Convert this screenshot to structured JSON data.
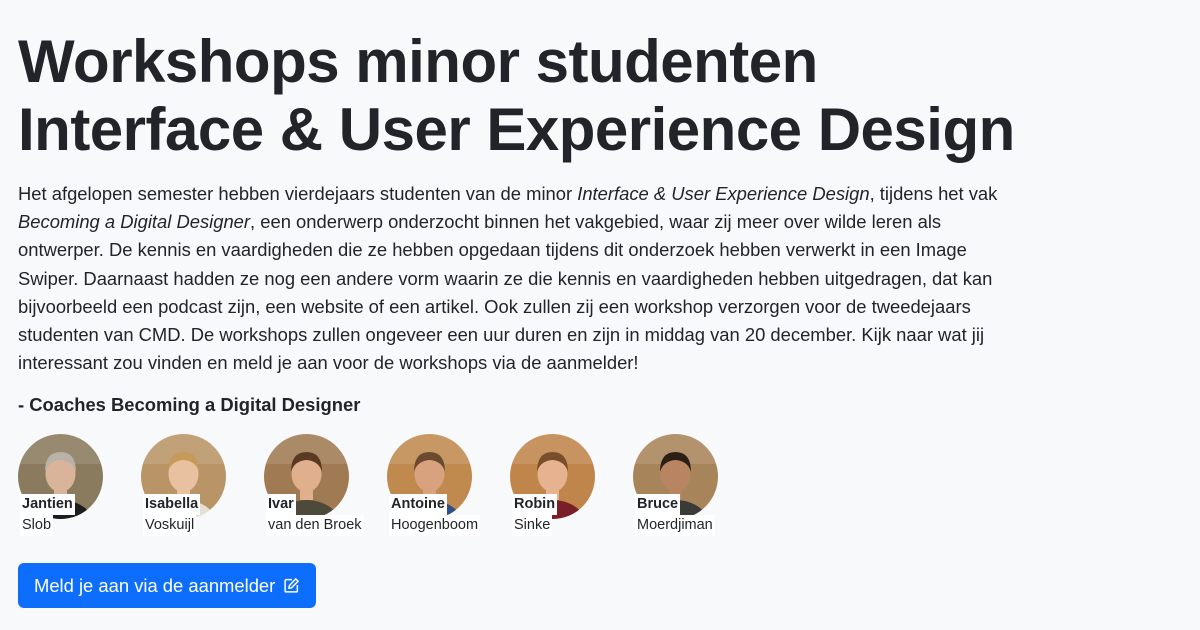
{
  "header": {
    "title_line1": "Workshops minor studenten",
    "title_line2": "Interface & User Experience Design"
  },
  "intro": {
    "p1": "Het afgelopen semester hebben vierdejaars studenten van de minor ",
    "minor_name": "Interface & User Experience Design",
    "p2": ", tijdens het vak ",
    "course_name": "Becoming a Digital Designer",
    "p3": ", een onderwerp onderzocht binnen het vakgebied, waar zij meer over wilde leren als ontwerper. De kennis en vaardigheden die ze hebben opgedaan tijdens dit onderzoek hebben verwerkt in een Image Swiper. Daarnaast hadden ze nog een andere vorm waarin ze die kennis en vaardigheden hebben uitgedragen, dat kan bijvoorbeeld een podcast zijn, een website of een artikel. Ook zullen zij een workshop verzorgen voor de tweedejaars studenten van CMD. De workshops zullen ongeveer een uur duren en zijn in middag van 20 december. Kijk naar wat jij interessant zou vinden en meld je aan voor de workshops via de aanmelder!"
  },
  "signature": "- Coaches Becoming a Digital Designer",
  "coaches": [
    {
      "first": "Jantien",
      "last": "Slob",
      "bg": "#8a7a5e",
      "skin": "#d9b49a",
      "hair": "#b8b2a8",
      "shirt": "#1d1d1d"
    },
    {
      "first": "Isabella",
      "last": "Voskuijl",
      "bg": "#b89466",
      "skin": "#e8c2a0",
      "hair": "#c59a5a",
      "shirt": "#e6e0d4"
    },
    {
      "first": "Ivar",
      "last": "van den Broek",
      "bg": "#a07a52",
      "skin": "#e0b08c",
      "hair": "#5a3a22",
      "shirt": "#4d4a3c"
    },
    {
      "first": "Antoine",
      "last": "Hoogenboom",
      "bg": "#c08a4e",
      "skin": "#d9a27e",
      "hair": "#6b4a30",
      "shirt": "#2e4f8a"
    },
    {
      "first": "Robin",
      "last": "Sinke",
      "bg": "#c0854a",
      "skin": "#e6b290",
      "hair": "#7a4e2a",
      "shirt": "#7a1f28"
    },
    {
      "first": "Bruce",
      "last": "Moerdjiman",
      "bg": "#a8845a",
      "skin": "#b98462",
      "hair": "#2c1f16",
      "shirt": "#3a3a36"
    }
  ],
  "cta": {
    "label": "Meld je aan via de aanmelder",
    "icon": "external-edit-icon"
  },
  "colors": {
    "background": "#f8f9fa",
    "text": "#212529",
    "primary": "#0d6efd"
  }
}
